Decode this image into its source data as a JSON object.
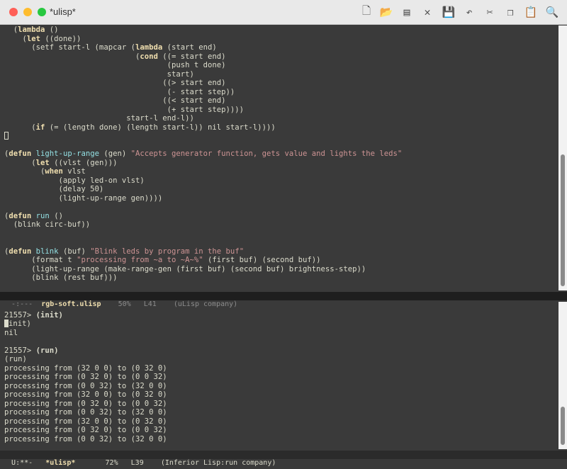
{
  "window": {
    "title": "*ulisp*"
  },
  "toolbar": {
    "buttons": [
      {
        "name": "new-file-icon",
        "glyph": "🗋"
      },
      {
        "name": "open-folder-icon",
        "glyph": "📂"
      },
      {
        "name": "save-icon",
        "glyph": "▤"
      },
      {
        "name": "close-icon",
        "glyph": "✕"
      },
      {
        "name": "save-disk-icon",
        "glyph": "💾"
      },
      {
        "name": "undo-icon",
        "glyph": "↶"
      },
      {
        "name": "cut-icon",
        "glyph": "✂"
      },
      {
        "name": "copy-icon",
        "glyph": "❐"
      },
      {
        "name": "paste-icon",
        "glyph": "📋"
      },
      {
        "name": "search-icon",
        "glyph": "🔍"
      }
    ]
  },
  "top_pane": {
    "lines": [
      [
        {
          "t": "  ("
        },
        {
          "t": "lambda",
          "c": "k"
        },
        {
          "t": " ()"
        }
      ],
      [
        {
          "t": "    ("
        },
        {
          "t": "let",
          "c": "k"
        },
        {
          "t": " ((done))"
        }
      ],
      [
        {
          "t": "      (setf start-l (mapcar ("
        },
        {
          "t": "lambda",
          "c": "k"
        },
        {
          "t": " (start end)"
        }
      ],
      [
        {
          "t": "                             ("
        },
        {
          "t": "cond",
          "c": "k"
        },
        {
          "t": " ((= start end)"
        }
      ],
      [
        {
          "t": "                                    (push t done)"
        }
      ],
      [
        {
          "t": "                                    start)"
        }
      ],
      [
        {
          "t": "                                   ((> start end)"
        }
      ],
      [
        {
          "t": "                                    (- start step))"
        }
      ],
      [
        {
          "t": "                                   ((< start end)"
        }
      ],
      [
        {
          "t": "                                    (+ start step))))"
        }
      ],
      [
        {
          "t": "                           start-l end-l))"
        }
      ],
      [
        {
          "t": "      ("
        },
        {
          "t": "if",
          "c": "k"
        },
        {
          "t": " (= (length done) (length start-l)) nil start-l))))"
        }
      ],
      [
        {
          "t": "",
          "cursor": "box"
        }
      ],
      [
        {
          "t": ""
        }
      ],
      [
        {
          "t": "("
        },
        {
          "t": "defun",
          "c": "k"
        },
        {
          "t": " "
        },
        {
          "t": "light-up-range",
          "c": "f"
        },
        {
          "t": " (gen) "
        },
        {
          "t": "\"Accepts generator function, gets value and lights the leds\"",
          "c": "s"
        }
      ],
      [
        {
          "t": "      ("
        },
        {
          "t": "let",
          "c": "k"
        },
        {
          "t": " ((vlst (gen)))"
        }
      ],
      [
        {
          "t": "        ("
        },
        {
          "t": "when",
          "c": "k"
        },
        {
          "t": " vlst"
        }
      ],
      [
        {
          "t": "            (apply led-on vlst)"
        }
      ],
      [
        {
          "t": "            (delay 50)"
        }
      ],
      [
        {
          "t": "            (light-up-range gen))))"
        }
      ],
      [
        {
          "t": ""
        }
      ],
      [
        {
          "t": "("
        },
        {
          "t": "defun",
          "c": "k"
        },
        {
          "t": " "
        },
        {
          "t": "run",
          "c": "f"
        },
        {
          "t": " ()"
        }
      ],
      [
        {
          "t": "  (blink circ-buf))"
        }
      ],
      [
        {
          "t": ""
        }
      ],
      [
        {
          "t": ""
        }
      ],
      [
        {
          "t": "("
        },
        {
          "t": "defun",
          "c": "k"
        },
        {
          "t": " "
        },
        {
          "t": "blink",
          "c": "f"
        },
        {
          "t": " (buf) "
        },
        {
          "t": "\"Blink leds by program in the buf\"",
          "c": "s"
        }
      ],
      [
        {
          "t": "      (format t "
        },
        {
          "t": "\"processing from ~a to ~A~%\"",
          "c": "s"
        },
        {
          "t": " (first buf) (second buf))"
        }
      ],
      [
        {
          "t": "      (light-up-range (make-range-gen (first buf) (second buf) brightness-step))"
        }
      ],
      [
        {
          "t": "      (blink (rest buf)))"
        }
      ]
    ]
  },
  "top_modeline": {
    "status": "-:---",
    "buffer": "rgb-soft.ulisp",
    "percent": "50%",
    "line": "L41",
    "mode": "(uLisp company)"
  },
  "bottom_pane": {
    "lines": [
      [
        {
          "t": ""
        }
      ],
      [
        {
          "t": "21557> "
        },
        {
          "t": "(init)",
          "c": "b"
        }
      ],
      [
        {
          "t": "",
          "cursor": "block"
        },
        {
          "t": "init)"
        }
      ],
      [
        {
          "t": "nil"
        }
      ],
      [
        {
          "t": ""
        }
      ],
      [
        {
          "t": "21557> "
        },
        {
          "t": "(run)",
          "c": "b"
        }
      ],
      [
        {
          "t": "(run)"
        }
      ],
      [
        {
          "t": "processing from (32 0 0) to (0 32 0)"
        }
      ],
      [
        {
          "t": "processing from (0 32 0) to (0 0 32)"
        }
      ],
      [
        {
          "t": "processing from (0 0 32) to (32 0 0)"
        }
      ],
      [
        {
          "t": "processing from (32 0 0) to (0 32 0)"
        }
      ],
      [
        {
          "t": "processing from (0 32 0) to (0 0 32)"
        }
      ],
      [
        {
          "t": "processing from (0 0 32) to (32 0 0)"
        }
      ],
      [
        {
          "t": "processing from (32 0 0) to (0 32 0)"
        }
      ],
      [
        {
          "t": "processing from (0 32 0) to (0 0 32)"
        }
      ],
      [
        {
          "t": "processing from (0 0 32) to (32 0 0)"
        }
      ]
    ]
  },
  "bottom_modeline": {
    "status": "U:**-",
    "buffer": "*ulisp*",
    "percent": "72%",
    "line": "L39",
    "mode": "(Inferior Lisp:run company)"
  }
}
